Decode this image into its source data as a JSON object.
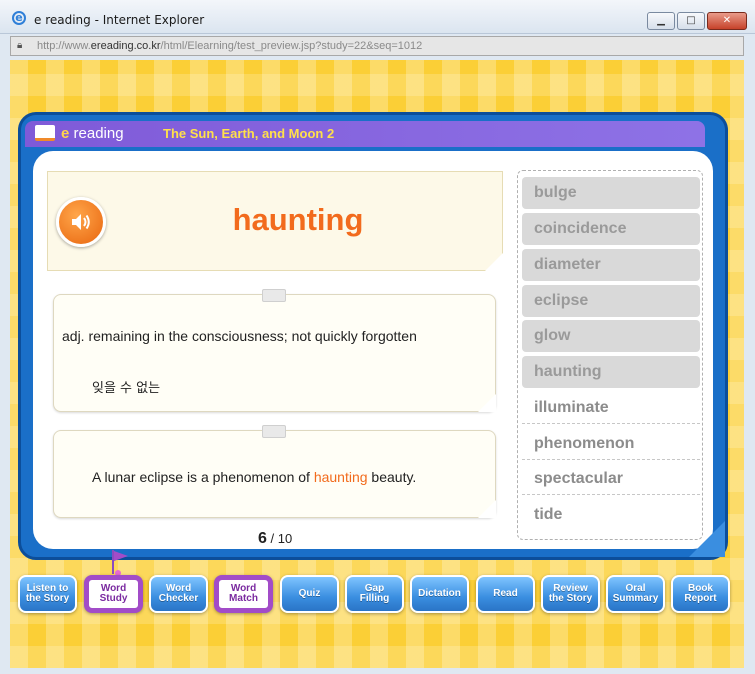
{
  "window": {
    "title": "e reading - Internet Explorer",
    "url_prefix": "http://www.",
    "url_domain": "ereading.co.kr",
    "url_path": "/html/Elearning/test_preview.jsp?study=22&seq=1012",
    "btn_min": "▁",
    "btn_max": "□",
    "btn_close": "✕"
  },
  "header": {
    "brand_e": "e",
    "brand_word": " reading",
    "story_title": "The Sun, Earth, and Moon 2"
  },
  "card": {
    "word": "haunting",
    "definition": "adj.  remaining in the consciousness; not quickly forgotten",
    "korean": "잊을 수 없는",
    "example_before": "A lunar eclipse is a phenomenon of ",
    "example_highlight": "haunting",
    "example_after": " beauty."
  },
  "pager": {
    "current": "6",
    "total": "/ 10"
  },
  "word_list": [
    {
      "label": "bulge",
      "state": "done"
    },
    {
      "label": "coincidence",
      "state": "done"
    },
    {
      "label": "diameter",
      "state": "done"
    },
    {
      "label": "eclipse",
      "state": "done"
    },
    {
      "label": "glow",
      "state": "done"
    },
    {
      "label": "haunting",
      "state": "done"
    },
    {
      "label": "illuminate",
      "state": "todo"
    },
    {
      "label": "phenomenon",
      "state": "todo"
    },
    {
      "label": "spectacular",
      "state": "todo"
    },
    {
      "label": "tide",
      "state": "todo"
    }
  ],
  "nav": [
    {
      "line1": "Listen to",
      "line2": "the Story"
    },
    {
      "line1": "Word",
      "line2": "Study"
    },
    {
      "line1": "Word",
      "line2": "Checker"
    },
    {
      "line1": "Word",
      "line2": "Match"
    },
    {
      "line1": "Quiz",
      "line2": ""
    },
    {
      "line1": "Gap",
      "line2": "Filling"
    },
    {
      "line1": "Dictation",
      "line2": ""
    },
    {
      "line1": "Read",
      "line2": ""
    },
    {
      "line1": "Review",
      "line2": "the Story"
    },
    {
      "line1": "Oral",
      "line2": "Summary"
    },
    {
      "line1": "Book",
      "line2": "Report"
    }
  ],
  "colors": {
    "accent_orange": "#f26b1d",
    "frame_blue": "#1a6fc8",
    "header_purple": "#8a6be0",
    "active_purple": "#a24cc8",
    "page_yellow": "#fbcf36"
  }
}
